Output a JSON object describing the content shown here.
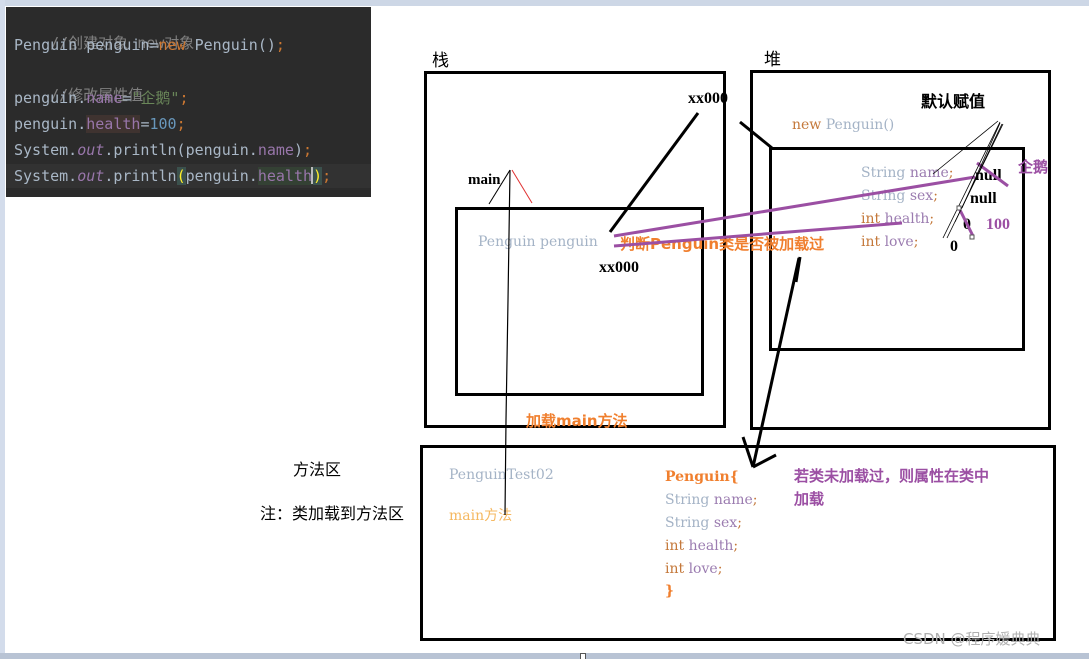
{
  "code_panel": {
    "lines": {
      "l1": "//创建对象 new对象",
      "l2a": "Penguin penguin=",
      "l2b": "new",
      "l2c": " Penguin()",
      "l2d": ";",
      "l3": "//修改属性值",
      "l4a": "penguin.",
      "l4b": "name",
      "l4c": "=",
      "l4d": "\"企鹅\"",
      "l4e": ";",
      "l5a": "penguin.",
      "l5b": "health",
      "l5c": "=",
      "l5d": "100",
      "l5e": ";",
      "l6a": "System.",
      "l6b": "out",
      "l6c": ".println(penguin.",
      "l6d": "name",
      "l6e": ")",
      "l6f": ";",
      "l7a": "System.",
      "l7b": "out",
      "l7c": ".println",
      "l7d": "(",
      "l7e": "penguin.",
      "l7f": "health",
      "l7g": ")",
      "l7h": ";"
    }
  },
  "diagram": {
    "stack": {
      "title": "栈",
      "frame_label": "main",
      "ref_address_top": "xx000",
      "var_decl": "Penguin penguin",
      "var_value": "xx000"
    },
    "heap": {
      "title": "堆",
      "default_values_label": "默认赋值",
      "new_keyword": "new",
      "constructor": " Penguin()",
      "fields": [
        {
          "type": "String",
          "name": " name",
          "semi": ";",
          "default": "null"
        },
        {
          "type": "String",
          "name": " sex",
          "semi": ";",
          "default": "null"
        },
        {
          "type": "int",
          "name": " health",
          "semi": ";",
          "default": "0"
        },
        {
          "type": "int",
          "name": " love",
          "semi": ";",
          "default": "0"
        }
      ],
      "assigned_name": "企鹅",
      "assigned_health": "100"
    },
    "annotations": {
      "check_loaded": "判断Penguin类是否被加载过",
      "load_main": "加载main方法",
      "not_loaded_note": "若类未加载过，则属性在类中",
      "not_loaded_note_2": "加载"
    },
    "method_area": {
      "title": "方法区",
      "note": "注：类加载到方法区",
      "class_name": "PenguinTest02",
      "main_method": "main方法",
      "penguin_class_header": "Penguin{",
      "fields": [
        {
          "type": "String",
          "name": " name",
          "semi": ";"
        },
        {
          "type": "String",
          "name": " sex",
          "semi": ";"
        },
        {
          "type": "int",
          "name": " health",
          "semi": ";"
        },
        {
          "type": "int",
          "name": " love",
          "semi": ";"
        }
      ],
      "closing_brace": "}"
    },
    "colors": {
      "orange": "#f07f2e",
      "purple": "#9b4fa3",
      "gray_blue": "#a4b3c6",
      "light_orange": "#f5b860"
    }
  },
  "watermark": "CSDN @程序媛典典"
}
